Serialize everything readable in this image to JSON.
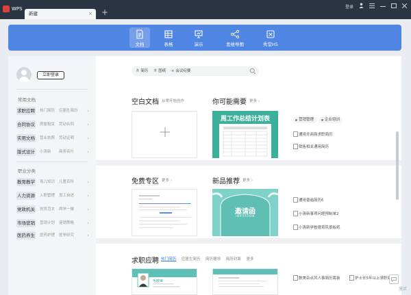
{
  "app": {
    "name": "WPS"
  },
  "tabs": [
    {
      "label": "新建"
    }
  ],
  "window": {
    "login": "登录"
  },
  "doc_types": [
    {
      "label": "文档",
      "active": true
    },
    {
      "label": "表格",
      "active": false
    },
    {
      "label": "演示",
      "active": false
    },
    {
      "label": "思维导图",
      "active": false
    },
    {
      "label": "秀堂H5",
      "active": false
    }
  ],
  "sidebar": {
    "login_button": "立即登录",
    "section1_title": "常用文档",
    "section1": [
      {
        "cat": "求职应聘",
        "sub1": "热门简历",
        "sub2": "应届生简历"
      },
      {
        "cat": "合同协议",
        "sub1": "房屋租赁",
        "sub2": "劳动合同"
      },
      {
        "cat": "实用文档",
        "sub1": "营业执照",
        "sub2": "劳动证明"
      },
      {
        "cat": "版式设计",
        "sub1": "小清新",
        "sub2": "商务名片"
      }
    ],
    "section2_title": "职业分类",
    "section2": [
      {
        "cat": "教育教学",
        "sub1": "育儿知识",
        "sub2": "儿童百科"
      },
      {
        "cat": "人力资源",
        "sub1": "入职管理",
        "sub2": "员工自述"
      },
      {
        "cat": "党政机关",
        "sub1": "党员范文",
        "sub2": "两学一做"
      },
      {
        "cat": "市场营销",
        "sub1": "营销计划",
        "sub2": "促销策略"
      },
      {
        "cat": "医药养生",
        "sub1": "医药护理",
        "sub2": "医学研究"
      }
    ]
  },
  "search": {
    "chips": [
      "简历",
      "图纸",
      "会议纪要"
    ]
  },
  "blank": {
    "title": "空白文档",
    "hint": "从零开始创作"
  },
  "recommend": {
    "title": "你可能需要",
    "more": "更多",
    "card_title": "周工作总结计划表",
    "tags": [
      "营销管理",
      "企业培训"
    ],
    "links": [
      "通用无商商求职简历",
      "销售相关通用简历"
    ]
  },
  "free": {
    "title": "免费专区",
    "more": "更多"
  },
  "newrec": {
    "title": "新品推荐",
    "more": "更多",
    "card_title": "邀请函",
    "card_sub": "INVITATION",
    "links": [
      "通用普遍简历6",
      "小清新事项问题预制单2",
      "小清新学校德育风景板纸"
    ]
  },
  "job": {
    "title": "求职应聘",
    "tabs": [
      "热门简历",
      "应届生简历",
      "简历赠领",
      "简历封面",
      "更多"
    ],
    "resume_name": "毛欧荣",
    "links": [
      "数美杂点风人事简历套装",
      "护士长5年以上求职简历"
    ]
  },
  "watermark": "激活"
}
